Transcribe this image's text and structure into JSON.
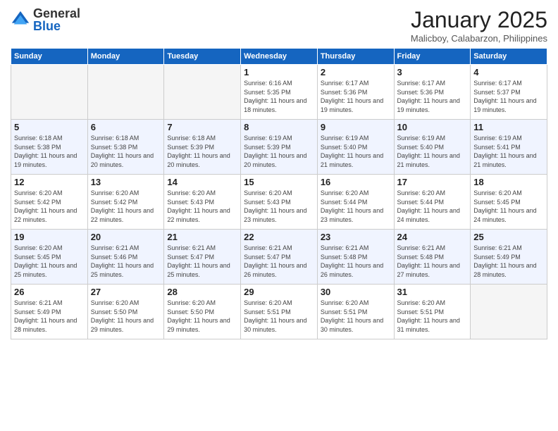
{
  "header": {
    "logo_general": "General",
    "logo_blue": "Blue",
    "month": "January 2025",
    "location": "Malicboy, Calabarzon, Philippines"
  },
  "days_of_week": [
    "Sunday",
    "Monday",
    "Tuesday",
    "Wednesday",
    "Thursday",
    "Friday",
    "Saturday"
  ],
  "weeks": [
    [
      {
        "day": "",
        "info": ""
      },
      {
        "day": "",
        "info": ""
      },
      {
        "day": "",
        "info": ""
      },
      {
        "day": "1",
        "info": "Sunrise: 6:16 AM\nSunset: 5:35 PM\nDaylight: 11 hours and 18 minutes."
      },
      {
        "day": "2",
        "info": "Sunrise: 6:17 AM\nSunset: 5:36 PM\nDaylight: 11 hours and 19 minutes."
      },
      {
        "day": "3",
        "info": "Sunrise: 6:17 AM\nSunset: 5:36 PM\nDaylight: 11 hours and 19 minutes."
      },
      {
        "day": "4",
        "info": "Sunrise: 6:17 AM\nSunset: 5:37 PM\nDaylight: 11 hours and 19 minutes."
      }
    ],
    [
      {
        "day": "5",
        "info": "Sunrise: 6:18 AM\nSunset: 5:38 PM\nDaylight: 11 hours and 19 minutes."
      },
      {
        "day": "6",
        "info": "Sunrise: 6:18 AM\nSunset: 5:38 PM\nDaylight: 11 hours and 20 minutes."
      },
      {
        "day": "7",
        "info": "Sunrise: 6:18 AM\nSunset: 5:39 PM\nDaylight: 11 hours and 20 minutes."
      },
      {
        "day": "8",
        "info": "Sunrise: 6:19 AM\nSunset: 5:39 PM\nDaylight: 11 hours and 20 minutes."
      },
      {
        "day": "9",
        "info": "Sunrise: 6:19 AM\nSunset: 5:40 PM\nDaylight: 11 hours and 21 minutes."
      },
      {
        "day": "10",
        "info": "Sunrise: 6:19 AM\nSunset: 5:40 PM\nDaylight: 11 hours and 21 minutes."
      },
      {
        "day": "11",
        "info": "Sunrise: 6:19 AM\nSunset: 5:41 PM\nDaylight: 11 hours and 21 minutes."
      }
    ],
    [
      {
        "day": "12",
        "info": "Sunrise: 6:20 AM\nSunset: 5:42 PM\nDaylight: 11 hours and 22 minutes."
      },
      {
        "day": "13",
        "info": "Sunrise: 6:20 AM\nSunset: 5:42 PM\nDaylight: 11 hours and 22 minutes."
      },
      {
        "day": "14",
        "info": "Sunrise: 6:20 AM\nSunset: 5:43 PM\nDaylight: 11 hours and 22 minutes."
      },
      {
        "day": "15",
        "info": "Sunrise: 6:20 AM\nSunset: 5:43 PM\nDaylight: 11 hours and 23 minutes."
      },
      {
        "day": "16",
        "info": "Sunrise: 6:20 AM\nSunset: 5:44 PM\nDaylight: 11 hours and 23 minutes."
      },
      {
        "day": "17",
        "info": "Sunrise: 6:20 AM\nSunset: 5:44 PM\nDaylight: 11 hours and 24 minutes."
      },
      {
        "day": "18",
        "info": "Sunrise: 6:20 AM\nSunset: 5:45 PM\nDaylight: 11 hours and 24 minutes."
      }
    ],
    [
      {
        "day": "19",
        "info": "Sunrise: 6:20 AM\nSunset: 5:45 PM\nDaylight: 11 hours and 25 minutes."
      },
      {
        "day": "20",
        "info": "Sunrise: 6:21 AM\nSunset: 5:46 PM\nDaylight: 11 hours and 25 minutes."
      },
      {
        "day": "21",
        "info": "Sunrise: 6:21 AM\nSunset: 5:47 PM\nDaylight: 11 hours and 25 minutes."
      },
      {
        "day": "22",
        "info": "Sunrise: 6:21 AM\nSunset: 5:47 PM\nDaylight: 11 hours and 26 minutes."
      },
      {
        "day": "23",
        "info": "Sunrise: 6:21 AM\nSunset: 5:48 PM\nDaylight: 11 hours and 26 minutes."
      },
      {
        "day": "24",
        "info": "Sunrise: 6:21 AM\nSunset: 5:48 PM\nDaylight: 11 hours and 27 minutes."
      },
      {
        "day": "25",
        "info": "Sunrise: 6:21 AM\nSunset: 5:49 PM\nDaylight: 11 hours and 28 minutes."
      }
    ],
    [
      {
        "day": "26",
        "info": "Sunrise: 6:21 AM\nSunset: 5:49 PM\nDaylight: 11 hours and 28 minutes."
      },
      {
        "day": "27",
        "info": "Sunrise: 6:20 AM\nSunset: 5:50 PM\nDaylight: 11 hours and 29 minutes."
      },
      {
        "day": "28",
        "info": "Sunrise: 6:20 AM\nSunset: 5:50 PM\nDaylight: 11 hours and 29 minutes."
      },
      {
        "day": "29",
        "info": "Sunrise: 6:20 AM\nSunset: 5:51 PM\nDaylight: 11 hours and 30 minutes."
      },
      {
        "day": "30",
        "info": "Sunrise: 6:20 AM\nSunset: 5:51 PM\nDaylight: 11 hours and 30 minutes."
      },
      {
        "day": "31",
        "info": "Sunrise: 6:20 AM\nSunset: 5:51 PM\nDaylight: 11 hours and 31 minutes."
      },
      {
        "day": "",
        "info": ""
      }
    ]
  ]
}
